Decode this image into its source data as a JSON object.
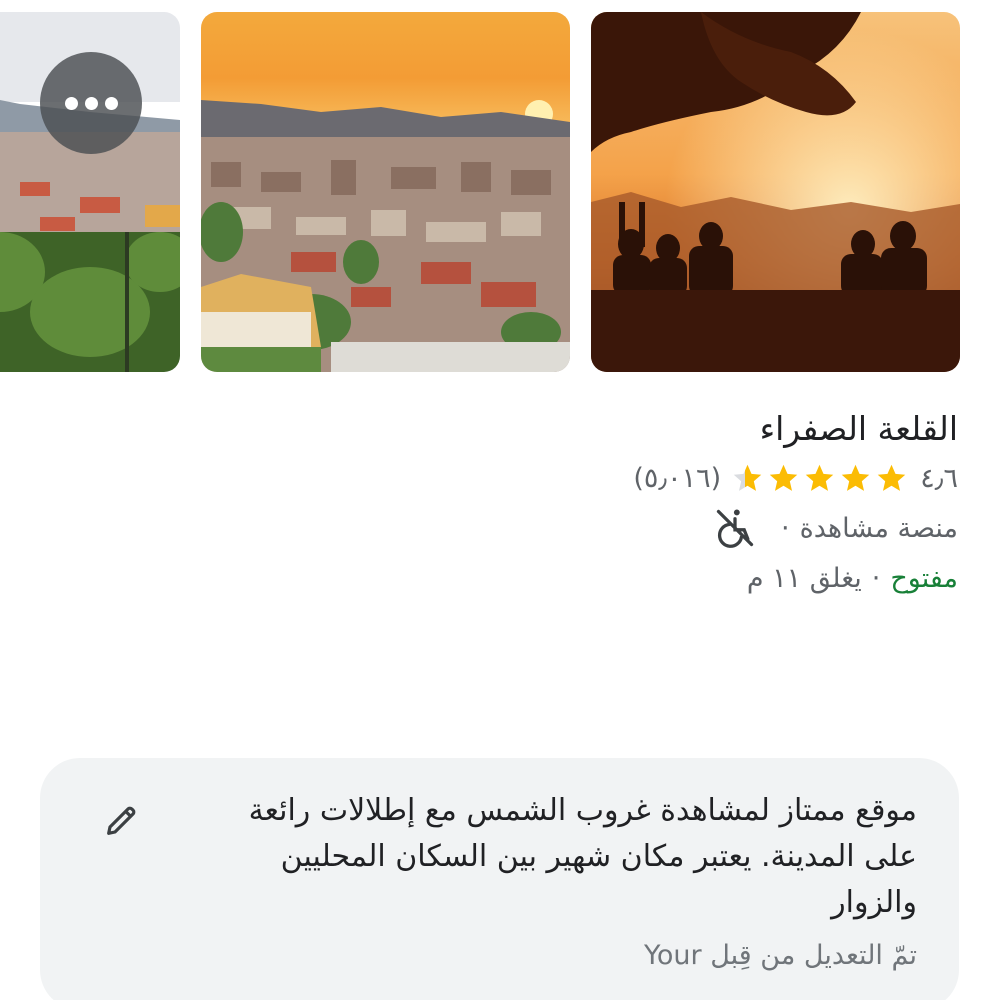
{
  "photos": [
    {
      "id": "photo-sunset-people"
    },
    {
      "id": "photo-city-view"
    },
    {
      "id": "photo-city-partial"
    }
  ],
  "more_button": {
    "icon": "more-horizontal-icon"
  },
  "place": {
    "name": "القلعة الصفراء",
    "rating": "٤٫٦",
    "stars_filled": 4.6,
    "review_count": "(٥٫٠١٦)",
    "type": "منصة مشاهدة",
    "separator": "·",
    "accessibility_icon": "not-wheelchair-accessible-icon",
    "status": "مفتوح",
    "hours": "يغلق ١١ م"
  },
  "note": {
    "text": "موقع ممتاز لمشاهدة غروب الشمس مع إطلالات رائعة على المدينة. يعتبر مكان شهير بين السكان المحليين والزوار",
    "footer": "تمّ التعديل من قِبل Your",
    "edit_icon": "pencil-icon"
  },
  "colors": {
    "star": "#fbbc04",
    "star_empty": "#dadce0",
    "open": "#188038",
    "card_bg": "#f1f3f4",
    "secondary_text": "#5f6368"
  }
}
